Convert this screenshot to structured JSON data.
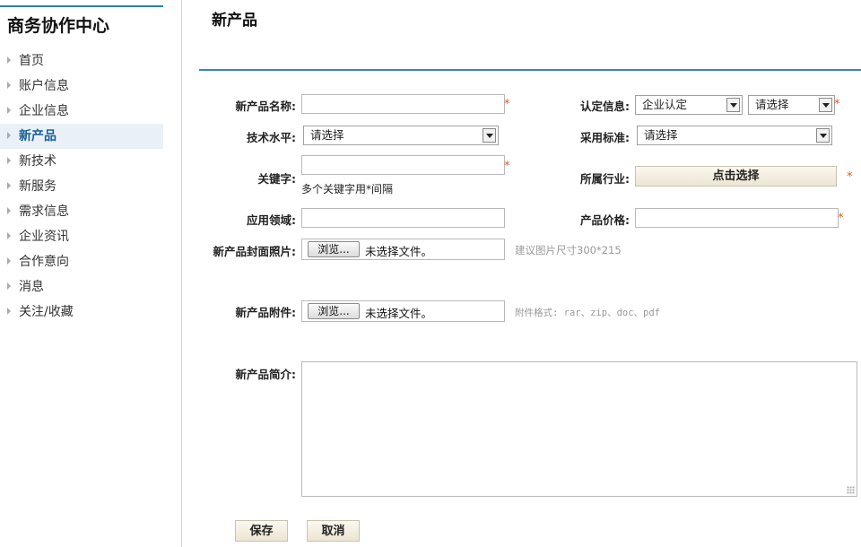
{
  "sidebar": {
    "title": "商务协作中心",
    "items": [
      {
        "label": "首页"
      },
      {
        "label": "账户信息"
      },
      {
        "label": "企业信息"
      },
      {
        "label": "新产品"
      },
      {
        "label": "新技术"
      },
      {
        "label": "新服务"
      },
      {
        "label": "需求信息"
      },
      {
        "label": "企业资讯"
      },
      {
        "label": "合作意向"
      },
      {
        "label": "消息"
      },
      {
        "label": "关注/收藏"
      }
    ],
    "active": "新产品"
  },
  "main": {
    "title": "新产品",
    "form": {
      "name_label": "新产品名称:",
      "name_value": "",
      "certification_label": "认定信息:",
      "certification_select1": "企业认定",
      "certification_select2": "请选择",
      "tech_level_label": "技术水平:",
      "tech_level_select": "请选择",
      "standard_label": "采用标准:",
      "standard_select": "请选择",
      "keywords_label": "关键字:",
      "keywords_value": "",
      "keywords_note": "多个关键字用*间隔",
      "industry_label": "所属行业:",
      "industry_button": "点击选择",
      "application_label": "应用领域:",
      "application_value": "",
      "price_label": "产品价格:",
      "price_value": "",
      "cover_label": "新产品封面照片:",
      "cover_browse": "浏览...",
      "cover_status": "未选择文件。",
      "cover_hint": "建议图片尺寸300*215",
      "attachment_label": "新产品附件:",
      "attachment_browse": "浏览...",
      "attachment_status": "未选择文件。",
      "attachment_hint": "附件格式: rar、zip、doc、pdf",
      "intro_label": "新产品简介:",
      "intro_value": "",
      "required_mark": "*"
    },
    "buttons": {
      "save": "保存",
      "cancel": "取消"
    }
  }
}
